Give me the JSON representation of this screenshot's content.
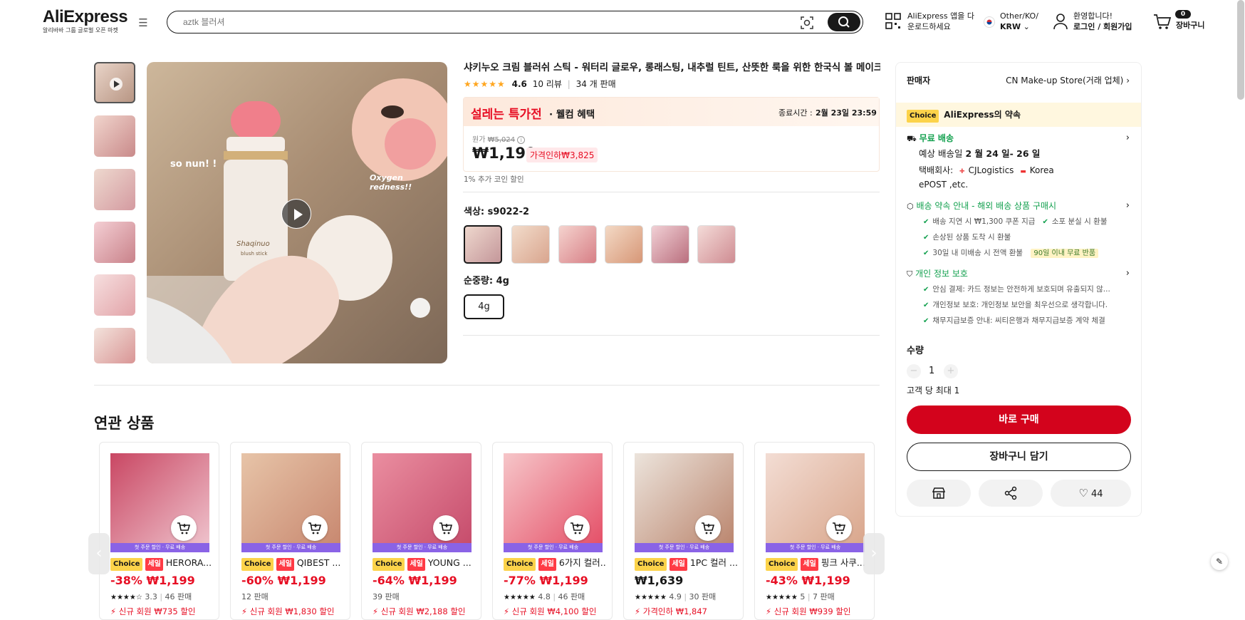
{
  "header": {
    "logo_text": "AliExpress",
    "logo_sub": "알리바바 그룹 글로벌 오픈 마켓",
    "search_placeholder": "aztk 블러셔",
    "app_line1": "AliExpress 앱을 다",
    "app_line2": "운로드하세요",
    "region_line1": "Other/KO/",
    "region_line2": "KRW",
    "user_line1": "환영합니다!",
    "user_line2": "로그인 / 회원가입",
    "cart_count": "0",
    "cart_label": "장바구니"
  },
  "gallery": {
    "overlay_left": "so nun! !",
    "overlay_right": "Oxygen redness!!",
    "product_label": "Shaqinuo",
    "product_sub": "blush stick"
  },
  "product": {
    "title": "샤키누오 크림 블러쉬 스틱 - 워터리 글로우, 롱래스팅, 내추럴 틴트, 산뜻한 룩을 위한 한국식 볼 메이크업",
    "rating": "4.6",
    "stars": 4.6,
    "reviews": "10 리뷰",
    "sold": "34 개 판매",
    "promo_title": "설레는 특가전",
    "promo_sub": "· 웰컴 혜택",
    "end_label": "종료시간 :",
    "end_time": "2월 23일 23:59",
    "orig_label": "원가",
    "orig_price": "₩5,024",
    "price": "₩1,199",
    "discount": "가격인하₩3,825",
    "coin": "1% 추가 코인 할인",
    "color_label": "색상:",
    "color_value": "s9022-2",
    "weight_label": "순중량:",
    "weight_value": "4g",
    "weight_option": "4g"
  },
  "panel": {
    "seller_label": "판매자",
    "seller_name": "CN Make-up Store(거래 업체)",
    "choice": "Choice",
    "promise": "AliExpress의 약속",
    "free_ship": "무료 배송",
    "delivery_label": "예상 배송일",
    "delivery_date": "2 월 24 일- 26 일",
    "carrier_label": "택배회사:",
    "carrier_line1": "CJLogistics",
    "carrier_line1b": "Korea",
    "carrier_line2": "ePOST ,etc.",
    "guarantee_title": "배송 약속 안내 - 해외 배송 상품 구매시",
    "guarantee_items": [
      "배송 지연 시 ₩1,300 쿠폰 지급",
      "소포 분실 시 환불",
      "손상된 상품 도착 시 환불",
      "30일 내 미배송 시 전액 환불"
    ],
    "return_badge": "90일 이내 무료 반품",
    "privacy_title": "개인 정보 보호",
    "privacy_items": [
      "안심 결제: 카드 정보는 안전하게 보호되며 유출되지 않...",
      "개인정보 보호: 개인정보 보안을 최우선으로 생각합니다.",
      "채무지급보증 안내: 씨티은행과 채무지급보증 계약 체결"
    ],
    "qty_label": "수량",
    "qty_value": "1",
    "qty_limit": "고객 당 최대 1",
    "buy_now": "바로 구매",
    "add_cart": "장바구니 담기",
    "wishlist_count": "44"
  },
  "related": {
    "title": "연관 상품",
    "promo_strip": "첫 주문 할인 · 무료 배송",
    "choice": "Choice",
    "sale": "세일",
    "cards": [
      {
        "name": "HERORA...",
        "discount": "-38%",
        "price": "₩1,199",
        "rating": "3.3",
        "stars": 3.3,
        "sold": "46 판매",
        "coupon": "신규 회원 ₩735 할인",
        "sale": true,
        "c1": "#c94763",
        "c2": "#f0c7d0"
      },
      {
        "name": "QIBEST ...",
        "discount": "-60%",
        "price": "₩1,199",
        "rating": "",
        "stars": 0,
        "sold": "12 판매",
        "coupon": "신규 회원 ₩1,830 할인",
        "sale": true,
        "c1": "#e7c4a8",
        "c2": "#c7866e"
      },
      {
        "name": "YOUNG ...",
        "discount": "-64%",
        "price": "₩1,199",
        "rating": "",
        "stars": 0,
        "sold": "39 판매",
        "coupon": "신규 회원 ₩2,188 할인",
        "sale": true,
        "c1": "#ea8ea0",
        "c2": "#c54a6a"
      },
      {
        "name": "6가지 컬러...",
        "discount": "-77%",
        "price": "₩1,199",
        "rating": "4.8",
        "stars": 4.8,
        "sold": "46 판매",
        "coupon": "신규 회원 ₩4,100 할인",
        "sale": true,
        "c1": "#f6c6c9",
        "c2": "#e44b64"
      },
      {
        "name": "1PC 컬러 ...",
        "discount": "",
        "price": "₩1,639",
        "rating": "4.9",
        "stars": 4.9,
        "sold": "30 판매",
        "coupon": "가격인하 ₩1,847",
        "sale": true,
        "c1": "#ece4dc",
        "c2": "#b9826a"
      },
      {
        "name": "핑크 사쿠...",
        "discount": "-43%",
        "price": "₩1,199",
        "rating": "5",
        "stars": 5,
        "sold": "7 판매",
        "coupon": "신규 회원 ₩939 할인",
        "sale": true,
        "c1": "#f3ddd4",
        "c2": "#d8a489"
      }
    ]
  },
  "colors": {
    "accent": "#e70f24",
    "buy": "#d3031c",
    "green": "#12a04e",
    "choice": "#fcd34a"
  }
}
